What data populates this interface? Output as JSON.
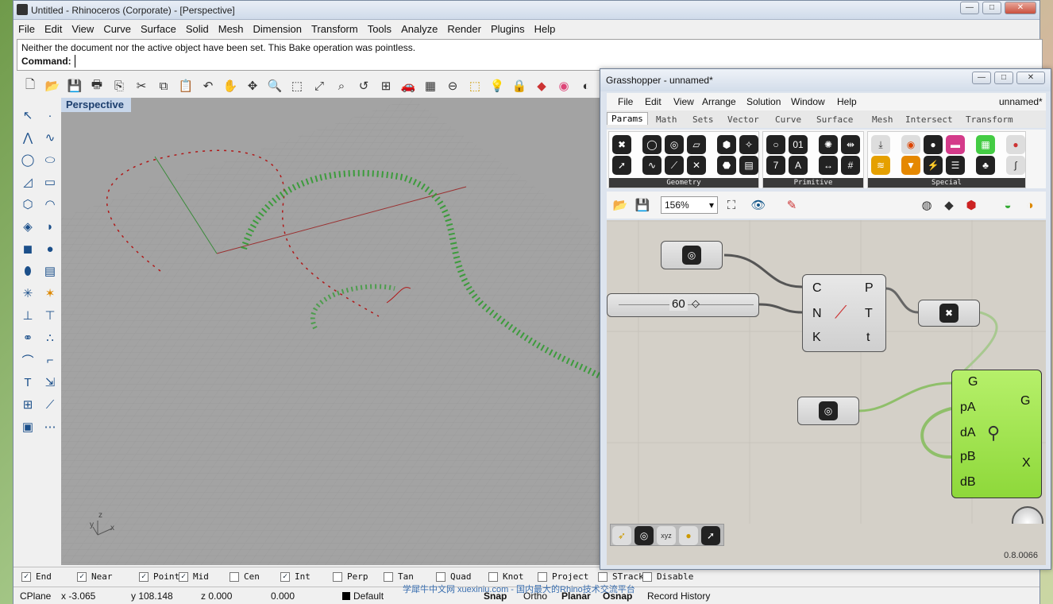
{
  "rhino": {
    "title": "Untitled - Rhinoceros (Corporate) - [Perspective]",
    "menu": [
      "File",
      "Edit",
      "View",
      "Curve",
      "Surface",
      "Solid",
      "Mesh",
      "Dimension",
      "Transform",
      "Tools",
      "Analyze",
      "Render",
      "Plugins",
      "Help"
    ],
    "history_line": "Neither the document nor the active object have been set. This Bake operation was pointless.",
    "command_label": "Command:",
    "viewport_label": "Perspective",
    "axis": {
      "z": "z",
      "y": "y",
      "x": "x"
    },
    "osnaps": [
      {
        "label": "End",
        "checked": true
      },
      {
        "label": "Near",
        "checked": true
      },
      {
        "label": "Point",
        "checked": true
      },
      {
        "label": "Mid",
        "checked": true
      },
      {
        "label": "Cen",
        "checked": false
      },
      {
        "label": "Int",
        "checked": true
      },
      {
        "label": "Perp",
        "checked": false
      },
      {
        "label": "Tan",
        "checked": false
      },
      {
        "label": "Quad",
        "checked": false
      },
      {
        "label": "Knot",
        "checked": false
      },
      {
        "label": "Project",
        "checked": false
      },
      {
        "label": "STrack",
        "checked": false
      },
      {
        "label": "Disable",
        "checked": false
      }
    ],
    "status": {
      "cplane": "CPlane",
      "x": "x -3.065",
      "y": "y 108.148",
      "z": "z 0.000",
      "d": "0.000",
      "layer": "Default",
      "snap": "Snap",
      "ortho": "Ortho",
      "planar": "Planar",
      "osnap": "Osnap",
      "record": "Record History"
    }
  },
  "gh": {
    "title": "Grasshopper - unnamed*",
    "menu": [
      "File",
      "Edit",
      "View",
      "Arrange",
      "Solution",
      "Window",
      "Help"
    ],
    "doc_name": "unnamed*",
    "tabs": [
      "Params",
      "Math",
      "Sets",
      "Vector",
      "Curve",
      "Surface",
      "Mesh",
      "Intersect",
      "Transform"
    ],
    "groups": [
      "Geometry",
      "Primitive",
      "Special"
    ],
    "zoom": "156%",
    "slider_value": "60",
    "divide": {
      "inputs": [
        "C",
        "N",
        "K"
      ],
      "outputs": [
        "P",
        "T",
        "t"
      ]
    },
    "orient": {
      "inputs": [
        "G",
        "pA",
        "dA",
        "pB",
        "dB"
      ],
      "outputs": [
        "G",
        "X"
      ]
    },
    "version": "0.8.0066"
  },
  "watermark": "学犀牛中文网  xuexiniu.com  -  国内最大的Rhino技术交流平台"
}
